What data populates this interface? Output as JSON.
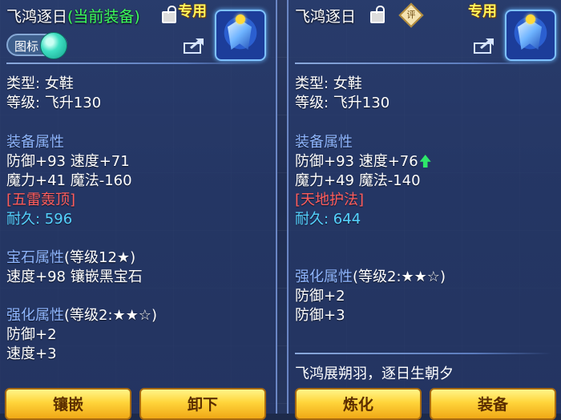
{
  "left": {
    "title": "飞鸿逐日",
    "current_tag": "(当前装备)",
    "special_badge": "专用",
    "icon_toggle_label": "图标",
    "type_line": "类型: 女鞋",
    "level_line": "等级: 飞升130",
    "equip_attr_title": "装备属性",
    "attr_line_1": "防御+93 速度+71",
    "attr_line_2": "魔力+41 魔法-160",
    "special_skill": "[五雷轰顶]",
    "durability": "耐久: 596",
    "gem_title": "宝石属性",
    "gem_level": "(等级12★)",
    "gem_line": "速度+98 镶嵌黑宝石",
    "enhance_title": "强化属性",
    "enhance_level": "(等级2:★★☆)",
    "enhance_line_1": "防御+2",
    "enhance_line_2": "速度+3",
    "buttons": [
      "镶嵌",
      "卸下"
    ]
  },
  "right": {
    "title": "飞鸿逐日",
    "judge_icon": "评",
    "special_badge": "专用",
    "type_line": "类型: 女鞋",
    "level_line": "等级: 飞升130",
    "equip_attr_title": "装备属性",
    "attr_line_1": "防御+93 速度+76",
    "attr_line_2": "魔力+49 魔法-140",
    "special_skill": "[天地护法]",
    "durability": "耐久: 644",
    "enhance_title": "强化属性",
    "enhance_level": "(等级2:★★☆)",
    "enhance_line_1": "防御+2",
    "enhance_line_2": "防御+3",
    "motto": "飞鸿展朔羽，逐日生朝夕",
    "buttons": [
      "炼化",
      "装备"
    ]
  },
  "colors": {
    "section_title": "#8fb6ff",
    "special_skill": "#ff5d5d",
    "durability": "#55d3ff",
    "current_tag": "#3cff5a",
    "special_badge": "#fff35a",
    "button": "#ffd43a"
  }
}
